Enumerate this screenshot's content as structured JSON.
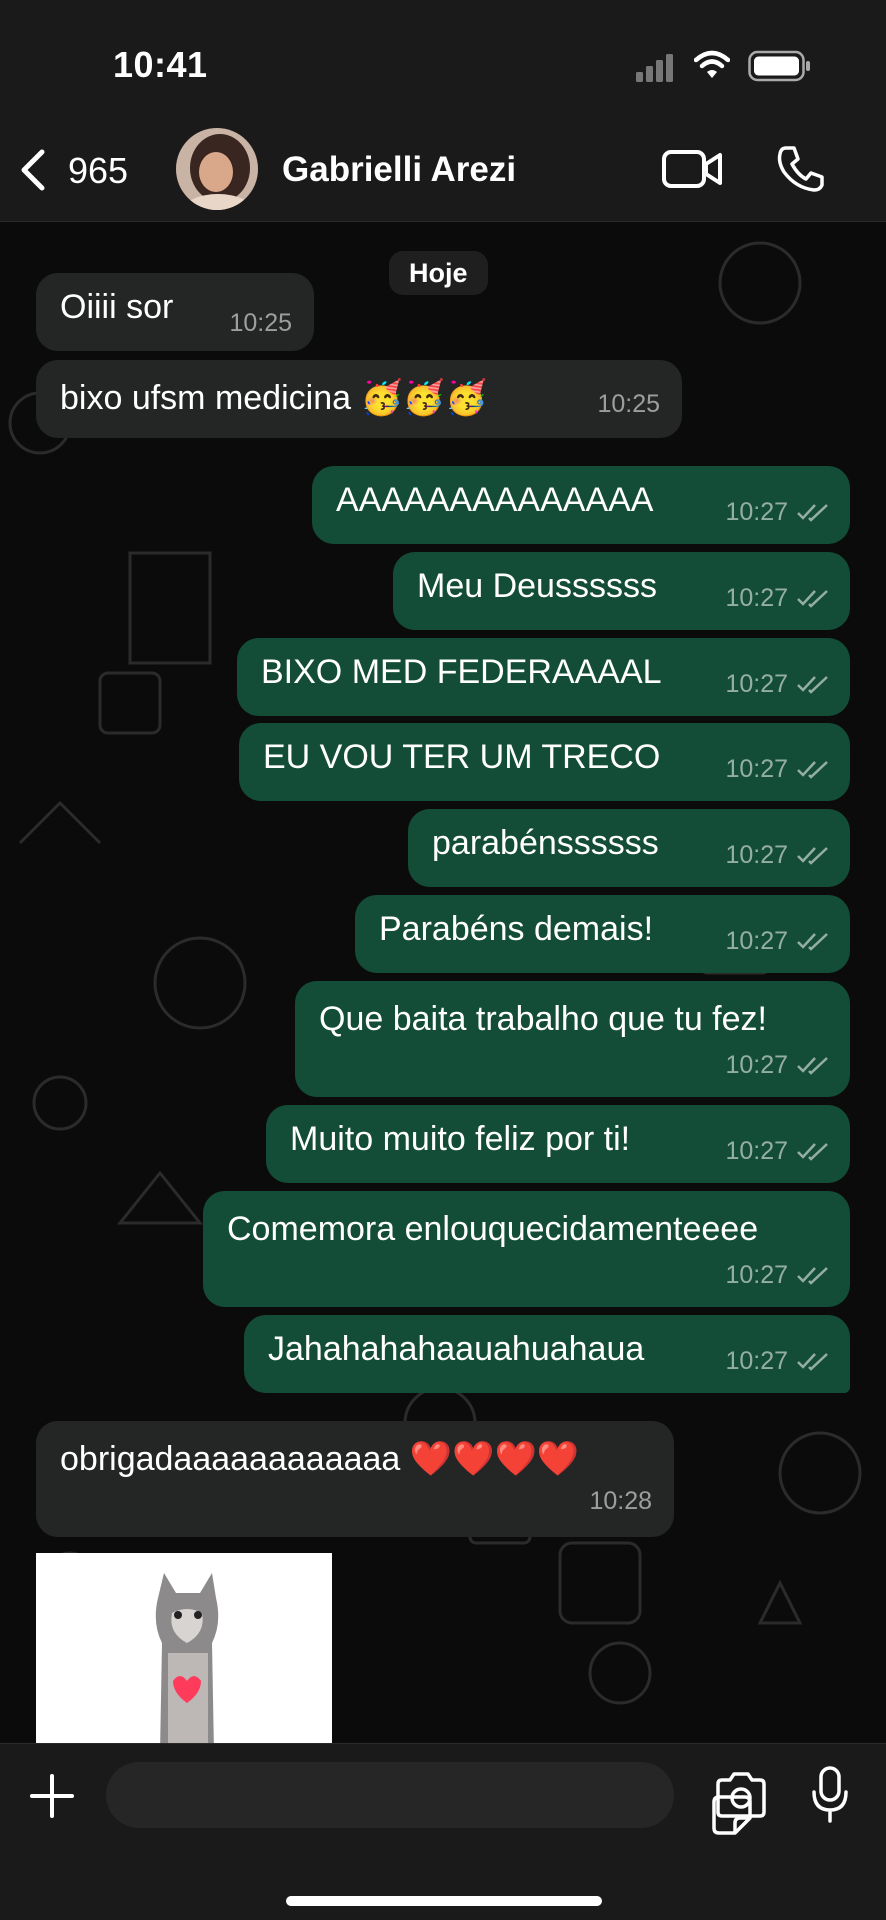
{
  "status_bar": {
    "time": "10:41"
  },
  "header": {
    "back_count": "965",
    "contact_name": "Gabrielli Arezi"
  },
  "chat": {
    "date_chip": "Hoje",
    "messages": [
      {
        "dir": "in",
        "text": "Oiiii sor",
        "time": "10:25"
      },
      {
        "dir": "in",
        "text": "bixo ufsm medicina 🥳🥳🥳",
        "time": "10:25"
      },
      {
        "dir": "out",
        "text": "AAAAAAAAAAAAAA",
        "time": "10:27"
      },
      {
        "dir": "out",
        "text": "Meu Deussssss",
        "time": "10:27"
      },
      {
        "dir": "out",
        "text": "BIXO MED FEDERAAAAL",
        "time": "10:27"
      },
      {
        "dir": "out",
        "text": "EU VOU TER UM TRECO",
        "time": "10:27"
      },
      {
        "dir": "out",
        "text": "parabénssssss",
        "time": "10:27"
      },
      {
        "dir": "out",
        "text": "Parabéns demais!",
        "time": "10:27"
      },
      {
        "dir": "out",
        "text": "Que baita trabalho que tu fez!",
        "time": "10:27"
      },
      {
        "dir": "out",
        "text": "Muito muito feliz por ti!",
        "time": "10:27"
      },
      {
        "dir": "out",
        "text": "Comemora enlouquecidamenteeee",
        "time": "10:27"
      },
      {
        "dir": "out",
        "text": "Jahahahahaauahuahaua",
        "time": "10:27"
      },
      {
        "dir": "in",
        "text": "obrigadaaaaaaaaaaaa ❤️❤️❤️❤️",
        "time": "10:28"
      }
    ],
    "sticker": {
      "icon": "cat-heart-sticker"
    }
  },
  "colors": {
    "incoming_bubble": "#242626",
    "outgoing_bubble": "#144d37",
    "background": "#0b0b0b",
    "bar": "#1a1a1a"
  },
  "icons": {
    "back": "chevron-left-icon",
    "video": "video-camera-icon",
    "phone": "phone-icon",
    "plus": "plus-icon",
    "sticker": "sticker-icon",
    "camera": "camera-icon",
    "mic": "microphone-icon"
  }
}
